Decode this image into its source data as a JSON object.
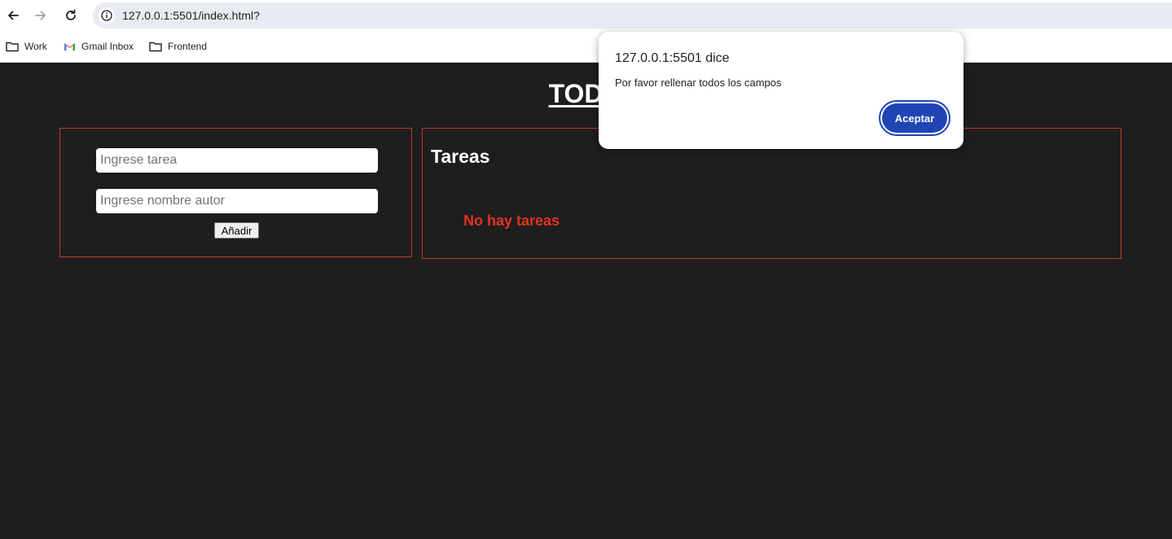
{
  "browser": {
    "url": "127.0.0.1:5501/index.html?",
    "bookmarks": [
      {
        "label": "Work",
        "icon": "folder-icon"
      },
      {
        "label": "Gmail Inbox",
        "icon": "gmail-icon"
      },
      {
        "label": "Frontend",
        "icon": "folder-icon"
      }
    ]
  },
  "page": {
    "title": "TODO",
    "form": {
      "task_placeholder": "Ingrese tarea",
      "author_placeholder": "Ingrese nombre autor",
      "add_label": "Añadir"
    },
    "tasks": {
      "heading": "Tareas",
      "empty_message": "No hay tareas"
    }
  },
  "dialog": {
    "title": "127.0.0.1:5501 dice",
    "message": "Por favor rellenar todos los campos",
    "accept_label": "Aceptar"
  },
  "colors": {
    "page_background": "#1e1e1e",
    "panel_border": "#c0392b",
    "empty_message": "#e5321f",
    "dialog_accent": "#1f45b4"
  }
}
